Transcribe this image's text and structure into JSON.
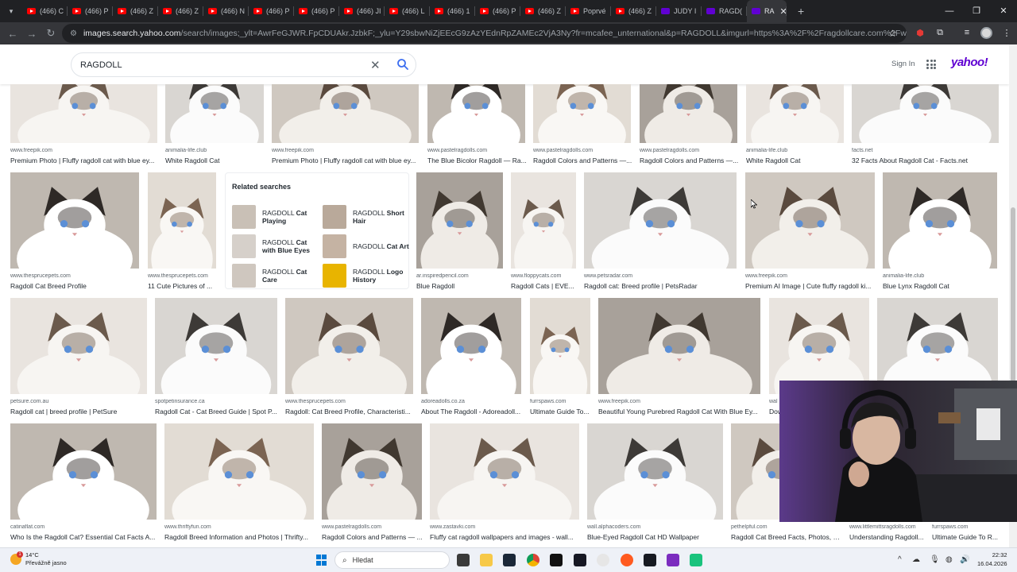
{
  "tabs": [
    {
      "label": "(466) C",
      "fav": "youtube"
    },
    {
      "label": "(466) P",
      "fav": "youtube"
    },
    {
      "label": "(466) Z",
      "fav": "youtube"
    },
    {
      "label": "(466) Z",
      "fav": "youtube"
    },
    {
      "label": "(466) N",
      "fav": "youtube"
    },
    {
      "label": "(466) P",
      "fav": "youtube"
    },
    {
      "label": "(466) P",
      "fav": "youtube"
    },
    {
      "label": "(466) JI",
      "fav": "youtube"
    },
    {
      "label": "(466) L",
      "fav": "youtube"
    },
    {
      "label": "(466) 1",
      "fav": "youtube"
    },
    {
      "label": "(466) P",
      "fav": "youtube"
    },
    {
      "label": "(466) Z",
      "fav": "youtube"
    },
    {
      "label": "Poprvé",
      "fav": "youtube"
    },
    {
      "label": "(466) Z",
      "fav": "youtube"
    },
    {
      "label": "JUDY I",
      "fav": "yahoo"
    },
    {
      "label": "RAGD(",
      "fav": "yahoo"
    },
    {
      "label": "RA",
      "fav": "yahoo",
      "active": true
    }
  ],
  "toolbar": {
    "url_host": "images.search.yahoo.com",
    "url_rest": "/search/images;_ylt=AwrFeGJWR.FpCDUAkr.JzbkF;_ylu=Y29sbwNiZjEEcG9zAzYEdnRpZAMEc2VjA3Ny?fr=mcafee_unternational&p=RAGDOLL&imgurl=https%3A%2F%2Fragdollcare.com%2Fwp-content%2Fuploads%2..."
  },
  "header": {
    "query": "RAGDOLL",
    "signin": "Sign In",
    "logo": "yahoo!"
  },
  "rows": [
    [
      {
        "src": "www.freepik.com",
        "title": "Premium Photo | Fluffy ragdoll cat with blue ey..."
      },
      {
        "src": "animalia-life.club",
        "title": "White Ragdoll Cat"
      },
      {
        "src": "www.freepik.com",
        "title": "Premium Photo | Fluffy ragdoll cat with blue ey..."
      },
      {
        "src": "www.pastelragdolls.com",
        "title": "The Blue Bicolor Ragdoll — Ra..."
      },
      {
        "src": "www.pastelragdolls.com",
        "title": "Ragdoll Colors and Patterns —..."
      },
      {
        "src": "www.pastelragdolls.com",
        "title": "Ragdoll Colors and Patterns —..."
      },
      {
        "src": "animalia-life.club",
        "title": "White Ragdoll Cat"
      },
      {
        "src": "facts.net",
        "title": "32 Facts About Ragdoll Cat - Facts.net"
      }
    ],
    [
      {
        "src": "www.thesprucepets.com",
        "title": "Ragdoll Cat Breed Profile"
      },
      {
        "src": "www.thesprucepets.com",
        "title": "11 Cute Pictures of ..."
      },
      {
        "src": "ar.inspiredpencil.com",
        "title": "Blue Ragdoll"
      },
      {
        "src": "www.floppycats.com",
        "title": "Ragdoll Cats | EVE..."
      },
      {
        "src": "www.petsradar.com",
        "title": "Ragdoll cat: Breed profile | PetsRadar"
      },
      {
        "src": "www.freepik.com",
        "title": "Premium AI Image | Cute fluffy ragdoll ki..."
      },
      {
        "src": "animalia-life.club",
        "title": "Blue Lynx Ragdoll Cat"
      }
    ],
    [
      {
        "src": "petsure.com.au",
        "title": "Ragdoll cat | breed profile | PetSure"
      },
      {
        "src": "spotpetinsurance.ca",
        "title": "Ragdoll Cat - Cat Breed Guide | Spot P..."
      },
      {
        "src": "www.thesprucepets.com",
        "title": "Ragdoll: Cat Breed Profile, Characteristi..."
      },
      {
        "src": "adoreadolls.co.za",
        "title": "About The Ragdoll - Adoreadoll..."
      },
      {
        "src": "furrspaws.com",
        "title": "Ultimate Guide To..."
      },
      {
        "src": "www.freepik.com",
        "title": "Beautiful Young Purebred Ragdoll Cat With Blue Ey..."
      },
      {
        "src": "wal",
        "title": "Dow"
      },
      {
        "src": "",
        "title": ""
      }
    ],
    [
      {
        "src": "catinaflat.com",
        "title": "Who Is the Ragdoll Cat? Essential Cat Facts A..."
      },
      {
        "src": "www.thriftyfun.com",
        "title": "Ragdoll Breed Information and Photos | Thrifty..."
      },
      {
        "src": "www.pastelragdolls.com",
        "title": "Ragdoll Colors and Patterns — ..."
      },
      {
        "src": "www.zastavki.com",
        "title": "Fluffy cat ragdoll wallpapers and images - wall..."
      },
      {
        "src": "wall.alphacoders.com",
        "title": "Blue-Eyed Ragdoll Cat HD Wallpaper"
      },
      {
        "src": "pethelpful.com",
        "title": "Ragdoll Cat Breed Facts, Photos, a..."
      },
      {
        "src": "www.littlemittsragdolls.com",
        "title": "Understanding Ragdoll..."
      },
      {
        "src": "furrspaws.com",
        "title": "Ultimate Guide To R..."
      }
    ]
  ],
  "related": {
    "title": "Related searches",
    "items": [
      {
        "pre": "RAGDOLL ",
        "bold": "Cat Playing"
      },
      {
        "pre": "RAGDOLL ",
        "bold": "Short Hair"
      },
      {
        "pre": "RAGDOLL ",
        "bold": "Cat with Blue Eyes"
      },
      {
        "pre": "RAGDOLL ",
        "bold": "Cat Art"
      },
      {
        "pre": "RAGDOLL ",
        "bold": "Cat Care"
      },
      {
        "pre": "RAGDOLL ",
        "bold": "Logo History"
      }
    ]
  },
  "taskbar": {
    "temp": "14°C",
    "weather": "Převážně jasno",
    "search_placeholder": "Hledat",
    "time": "22:32",
    "date": "16.04.2026"
  }
}
